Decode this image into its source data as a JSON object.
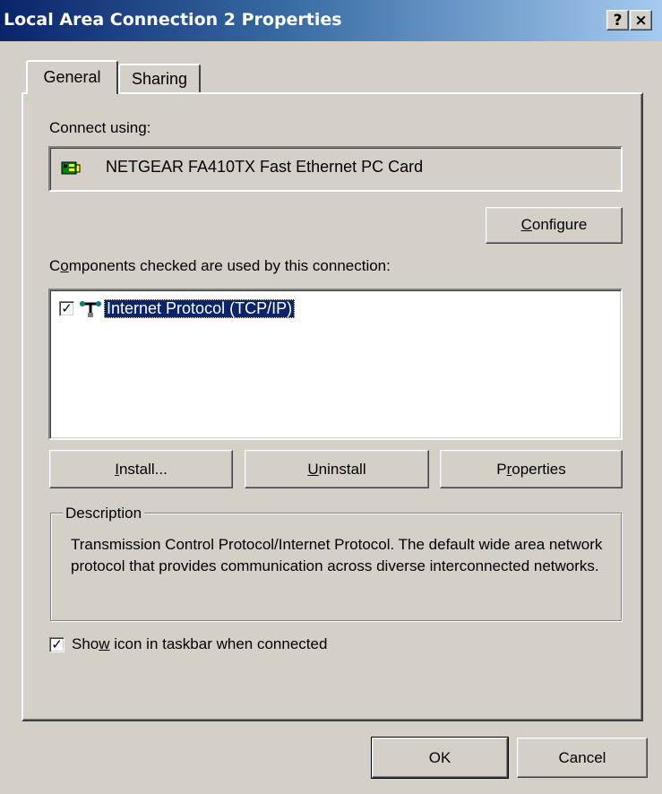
{
  "window": {
    "title": "Local Area Connection 2 Properties",
    "help_label": "?",
    "close_label": "×"
  },
  "tabs": [
    {
      "label": "General",
      "active": true
    },
    {
      "label": "Sharing",
      "active": false
    }
  ],
  "general": {
    "connect_using_label": "Connect using:",
    "adapter_name": "NETGEAR FA410TX Fast Ethernet PC Card",
    "configure_button": {
      "pre": "",
      "accel": "C",
      "post": "onfigure"
    },
    "components_label": {
      "pre": "C",
      "accel": "o",
      "post": "mponents checked are used by this connection:"
    },
    "components": [
      {
        "label": "Internet Protocol (TCP/IP)",
        "checked": true,
        "selected": true,
        "icon": "network-protocol-icon"
      }
    ],
    "install_button": {
      "pre": "",
      "accel": "I",
      "post": "nstall..."
    },
    "uninstall_button": {
      "pre": "",
      "accel": "U",
      "post": "ninstall"
    },
    "properties_button": {
      "pre": "P",
      "accel": "r",
      "post": "operties"
    },
    "description_title": "Description",
    "description_text": "Transmission Control Protocol/Internet Protocol. The default wide area network protocol that provides communication across diverse interconnected networks.",
    "show_icon": {
      "pre": "Sho",
      "accel": "w",
      "post": " icon in taskbar when connected",
      "checked": true
    }
  },
  "footer": {
    "ok_label": "OK",
    "cancel_label": "Cancel"
  },
  "colors": {
    "title_gradient_start": "#0a246a",
    "title_gradient_end": "#a6caf0",
    "face": "#d4d0c8",
    "selection": "#0a246a"
  }
}
